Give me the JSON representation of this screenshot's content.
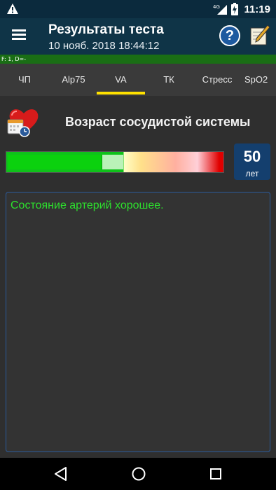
{
  "statusbar": {
    "network": "4G",
    "clock": "11:19"
  },
  "toolbar": {
    "title": "Результаты теста",
    "subtitle": "10 нояб. 2018  18:44:12",
    "help_label": "?"
  },
  "debug": {
    "text": "F: 1, D=-"
  },
  "tabs": [
    {
      "label": "ЧП",
      "active": false
    },
    {
      "label": "Alp75",
      "active": false
    },
    {
      "label": "VA",
      "active": true
    },
    {
      "label": "ТК",
      "active": false
    },
    {
      "label": "Стресс",
      "active": false
    },
    {
      "label": "SpO2",
      "active": false
    }
  ],
  "result": {
    "title": "Возраст сосудистой системы",
    "age_value": "50",
    "age_unit": "лет",
    "meter_fraction": 0.82,
    "message": "Состояние артерий хорошее."
  },
  "colors": {
    "accent": "#ffe100",
    "message_text": "#2de02d",
    "age_box": "#143f6e"
  },
  "icons": {
    "status": [
      "warning-icon",
      "signal-icon",
      "battery-icon"
    ],
    "toolbar": [
      "menu-icon",
      "help-icon",
      "edit-icon"
    ],
    "nav": [
      "back-icon",
      "home-icon",
      "recent-apps-icon"
    ]
  }
}
